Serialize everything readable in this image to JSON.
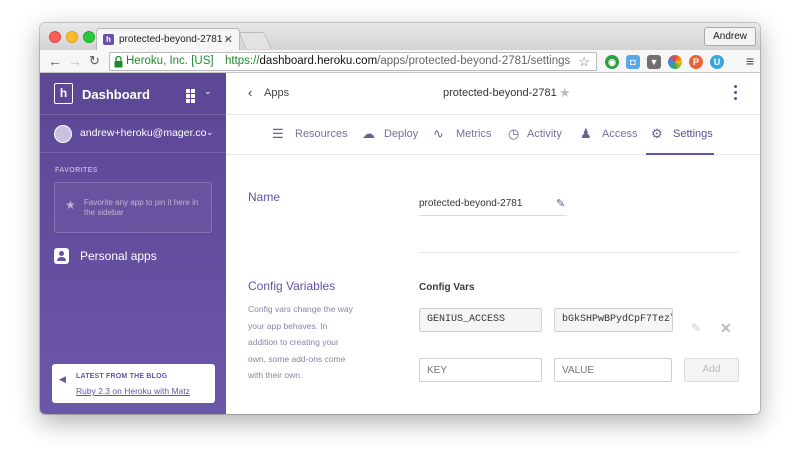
{
  "browser": {
    "tab_title": "protected-beyond-2781 · ",
    "profile_name": "Andrew",
    "secure_label": "Heroku, Inc. [US]",
    "url_scheme": "https://",
    "url_domain": "dashboard.heroku.com",
    "url_path": "/apps/protected-beyond-2781/settings"
  },
  "sidebar": {
    "title": "Dashboard",
    "user_email": "andrew+heroku@mager.co",
    "favorites_heading": "FAVORITES",
    "favorites_hint": "Favorite any app to pin it here in the sidebar",
    "personal_apps_label": "Personal apps",
    "blog_heading": "LATEST FROM THE BLOG",
    "blog_link": "Ruby 2.3 on Heroku with Matz"
  },
  "appbar": {
    "back_label": "Apps",
    "app_name": "protected-beyond-2781"
  },
  "tabs": [
    {
      "label": "Resources"
    },
    {
      "label": "Deploy"
    },
    {
      "label": "Metrics"
    },
    {
      "label": "Activity"
    },
    {
      "label": "Access"
    },
    {
      "label": "Settings"
    }
  ],
  "active_tab": "Settings",
  "settings": {
    "name_label": "Name",
    "app_name_value": "protected-beyond-2781",
    "config_label": "Config Variables",
    "config_desc": "Config vars change the way your app behaves. In addition to creating your own, some add-ons come with their own.",
    "config_vars_heading": "Config Vars",
    "vars": [
      {
        "key": "GENIUS_ACCESS",
        "value": "bGkSHPwBPydCpF7Tez\\"
      }
    ],
    "key_placeholder": "KEY",
    "value_placeholder": "VALUE",
    "add_label": "Add"
  },
  "colors": {
    "accent": "#6652a6",
    "sidebar_top": "#5b4794",
    "sidebar_bottom": "#6c56a9",
    "secure_green": "#1e8a2e"
  }
}
